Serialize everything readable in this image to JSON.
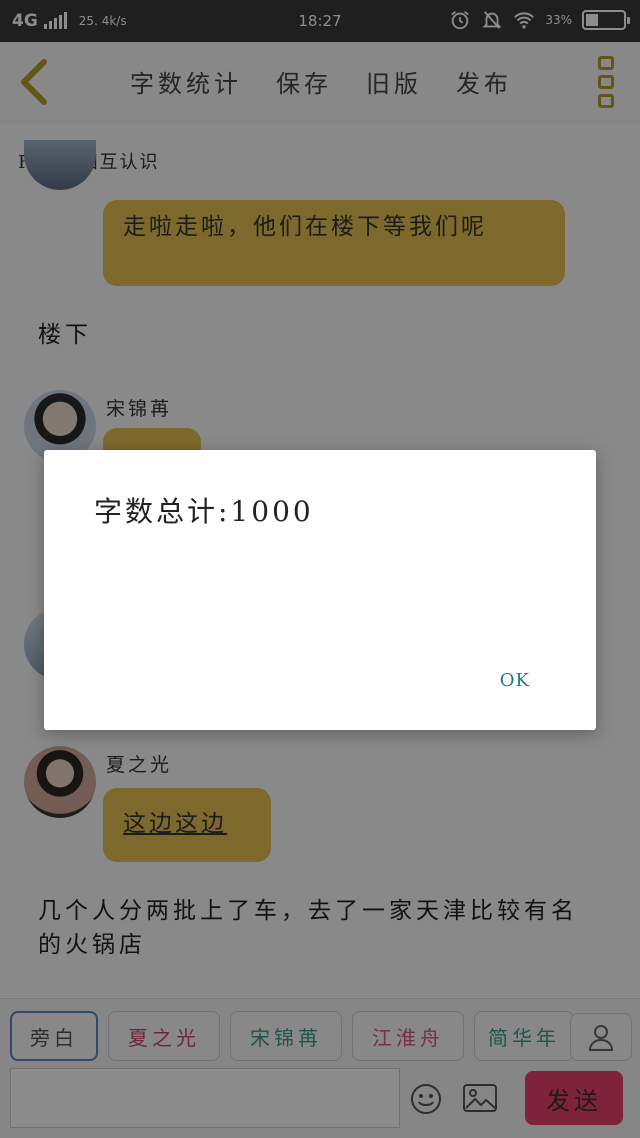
{
  "status_bar": {
    "network": "4G",
    "speed": "25. 4k/s",
    "time": "18:27",
    "battery": "33%",
    "battery_fill": 0.33
  },
  "toolbar": {
    "actions": [
      "字数统计",
      "保存",
      "旧版",
      "发布"
    ],
    "accent": "#b59c2a"
  },
  "chat": {
    "title": "Fifth 相互认识",
    "messages": [
      {
        "bubble": "走啦走啦，他们在楼下等我们呢"
      },
      {
        "narration": "楼下"
      },
      {
        "sender": "宋锦苒"
      },
      {
        "sender": "夏之光",
        "bubble": "这边这边"
      },
      {
        "narration": "几个人分两批上了车，去了一家天津比较有名的火锅店"
      }
    ]
  },
  "bottom": {
    "roles": [
      {
        "label": "旁白",
        "color": "#555555"
      },
      {
        "label": "夏之光",
        "color": "#c94a6a"
      },
      {
        "label": "宋锦苒",
        "color": "#3a9a8c"
      },
      {
        "label": "江淮舟",
        "color": "#d25a7a"
      },
      {
        "label": "简华年",
        "color": "#3a9a8c"
      }
    ],
    "send_label": "发送",
    "send_color": "#e8416f"
  },
  "dialog": {
    "message": "字数总计:1000",
    "ok_label": "OK"
  }
}
